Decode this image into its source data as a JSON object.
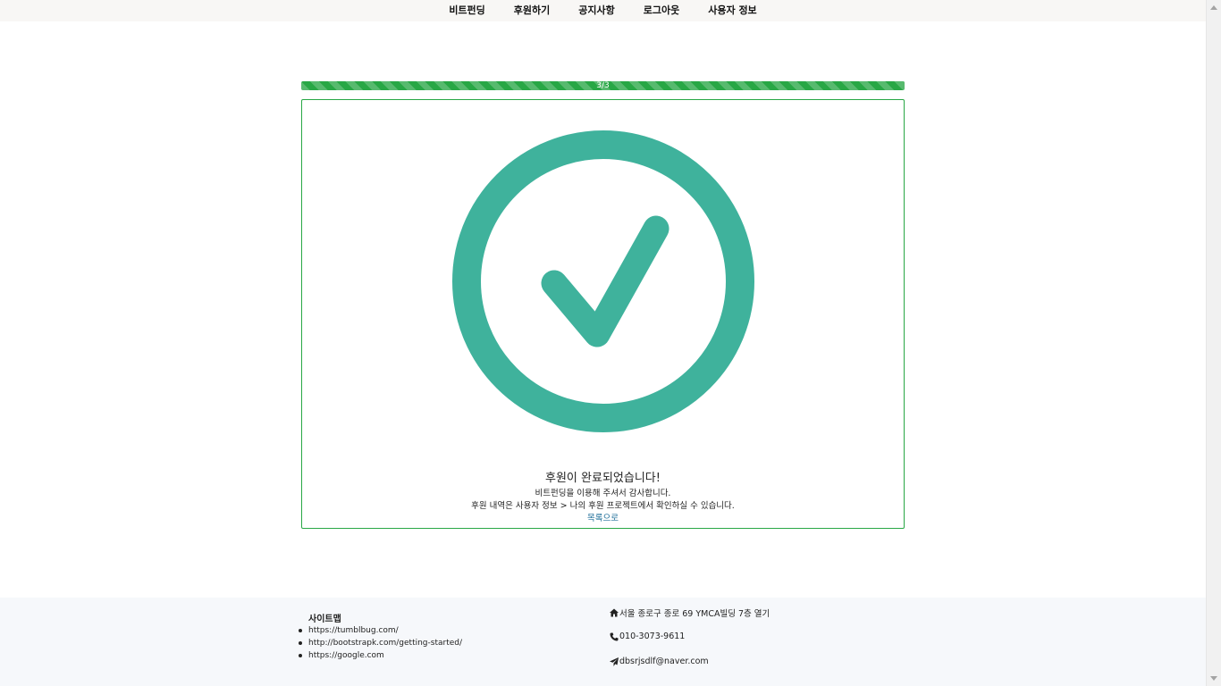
{
  "nav": {
    "items": [
      {
        "label": "비트펀딩"
      },
      {
        "label": "후원하기"
      },
      {
        "label": "공지사항"
      },
      {
        "label": "로그아웃"
      },
      {
        "label": "사용자 정보"
      }
    ]
  },
  "progress": {
    "label": "3/3",
    "fraction": 1.0,
    "color": "#28a745"
  },
  "card": {
    "icon": "check-circle-icon",
    "icon_color": "#3fb29c",
    "border_color": "#28a745",
    "title": "후원이 완료되었습니다!",
    "line1": "비트펀딩을 이용해 주셔서 감사합니다.",
    "line2": "후원 내역은 사용자 정보 > 나의 후원 프로젝트에서 확인하실 수 있습니다.",
    "back_link": "목록으로"
  },
  "footer": {
    "sitemap_title": "사이트맵",
    "sitemap_links": [
      "https://tumblbug.com/",
      "http://bootstrapk.com/getting-started/",
      "https://google.com"
    ],
    "address": "서울 종로구 종로 69 YMCA빌딩 7층 열기",
    "phone": "010-3073-9611",
    "email": "dbsrjsdlf@naver.com",
    "icons": [
      "home-icon",
      "phone-icon",
      "paper-plane-icon"
    ]
  }
}
